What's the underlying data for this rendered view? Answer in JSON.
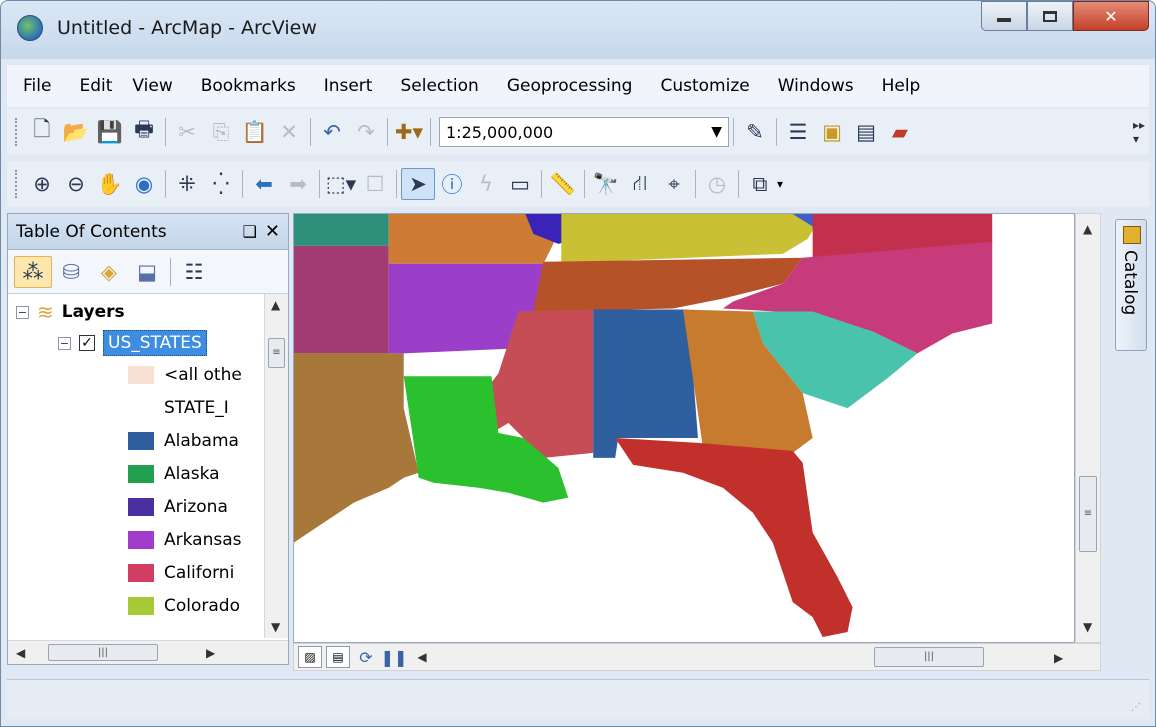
{
  "window": {
    "title": "Untitled - ArcMap - ArcView"
  },
  "menu": [
    "File",
    "Edit",
    "View",
    "Bookmarks",
    "Insert",
    "Selection",
    "Geoprocessing",
    "Customize",
    "Windows",
    "Help"
  ],
  "toolbar": {
    "scale_value": "1:25,000,000"
  },
  "toc": {
    "title": "Table Of Contents",
    "pin_glyph": "❑",
    "close_glyph": "✕",
    "root_label": "Layers",
    "layer_name": "US_STATES",
    "other_values_label": "<all othe",
    "field_label": "STATE_I",
    "legend": [
      {
        "label": "Alabama",
        "color": "#2f5f9e"
      },
      {
        "label": "Alaska",
        "color": "#22a050"
      },
      {
        "label": "Arizona",
        "color": "#4a2fa0"
      },
      {
        "label": "Arkansas",
        "color": "#a23ccb"
      },
      {
        "label": "Californi",
        "color": "#d13d63"
      },
      {
        "label": "Colorado",
        "color": "#a6c936"
      }
    ],
    "other_values_color": "#f8e1d2"
  },
  "catalog": {
    "label": "Catalog"
  },
  "map_colors": {
    "alabama": "#2f5f9e",
    "louisiana": "#2bc12e",
    "mississippi": "#c64d56",
    "arkansas": "#9b3fca",
    "tennessee": "#b55228",
    "georgia": "#c77b2e",
    "florida": "#c2302c",
    "south_carolina": "#49c3ac",
    "north_carolina": "#c73b7b",
    "texas": "#a7783a",
    "oklahoma": "#a23b72",
    "missouri": "#ce7b35",
    "kentucky": "#c9c035",
    "virginia": "#c2304e",
    "kansas": "#2e8f7b",
    "indiana": "#3a24b7",
    "west_virginia": "#3e5ecf"
  }
}
